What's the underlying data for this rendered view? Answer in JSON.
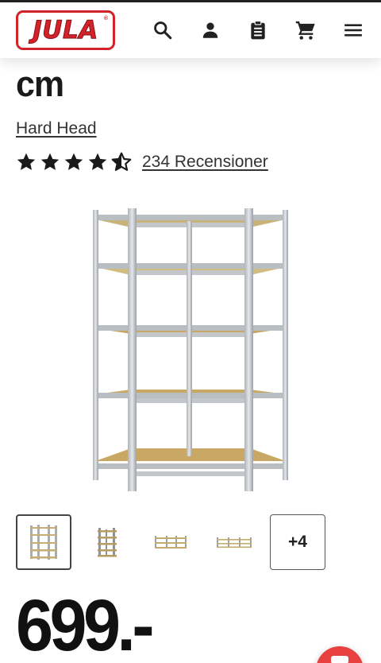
{
  "header": {
    "logo_text": "JULA",
    "logo_mark": "®",
    "icons": [
      "search-icon",
      "account-icon",
      "shopping-list-icon",
      "cart-icon",
      "menu-icon"
    ]
  },
  "product": {
    "title_tail": "cm",
    "brand": "Hard Head",
    "rating": 4.5,
    "rating_max": 5,
    "reviews_label": "234 Recensioner",
    "more_images_label": "+4",
    "price": "699.-"
  },
  "colors": {
    "brand_red": "#d2232a",
    "text": "#1a1a1a",
    "fab": "#e8403f"
  }
}
